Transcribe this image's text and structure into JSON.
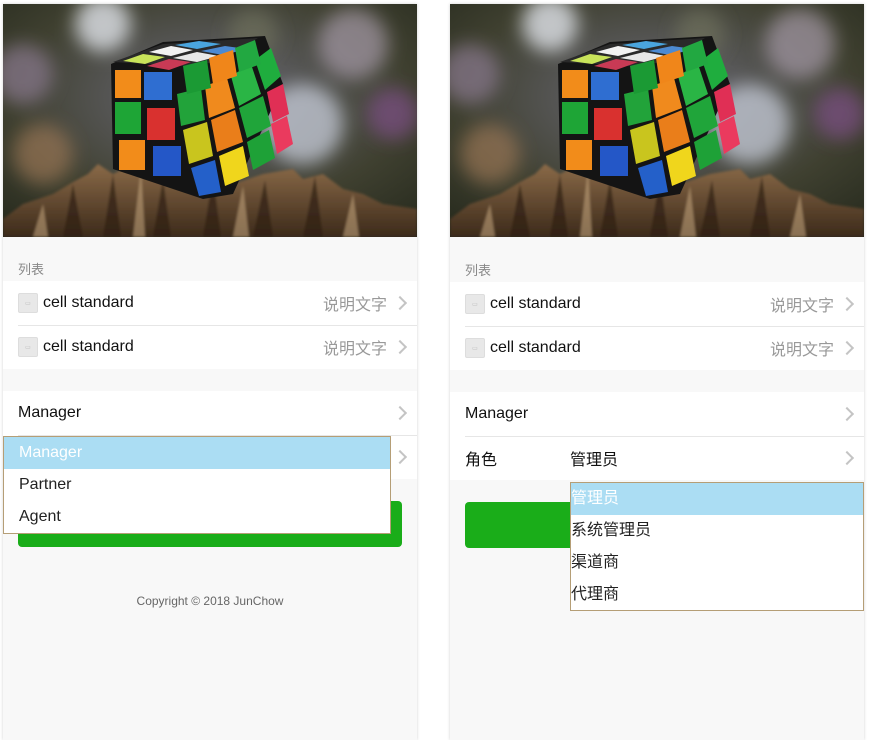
{
  "left": {
    "section_title": "列表",
    "cells": [
      {
        "title": "cell standard",
        "desc": "说明文字"
      },
      {
        "title": "cell standard",
        "desc": "说明文字"
      }
    ],
    "form_select_value": "Manager",
    "dropdown_options": [
      "Manager",
      "Partner",
      "Agent"
    ],
    "dropdown_selected": "Manager",
    "copyright": "Copyright © 2018 JunChow"
  },
  "right": {
    "section_title": "列表",
    "cells": [
      {
        "title": "cell standard",
        "desc": "说明文字"
      },
      {
        "title": "cell standard",
        "desc": "说明文字"
      }
    ],
    "form_select_value": "Manager",
    "role_label": "角色",
    "role_value": "管理员",
    "dropdown_options": [
      "管理员",
      "系统管理员",
      "渠道商",
      "代理商"
    ],
    "dropdown_selected": "管理员"
  },
  "colors": {
    "primary_button": "#1aad19",
    "dropdown_highlight": "#abddf3",
    "dropdown_border": "#b59e76"
  },
  "icons": {
    "cell_icon": "placeholder-thumbnail-icon",
    "chevron": "chevron-right-icon"
  }
}
